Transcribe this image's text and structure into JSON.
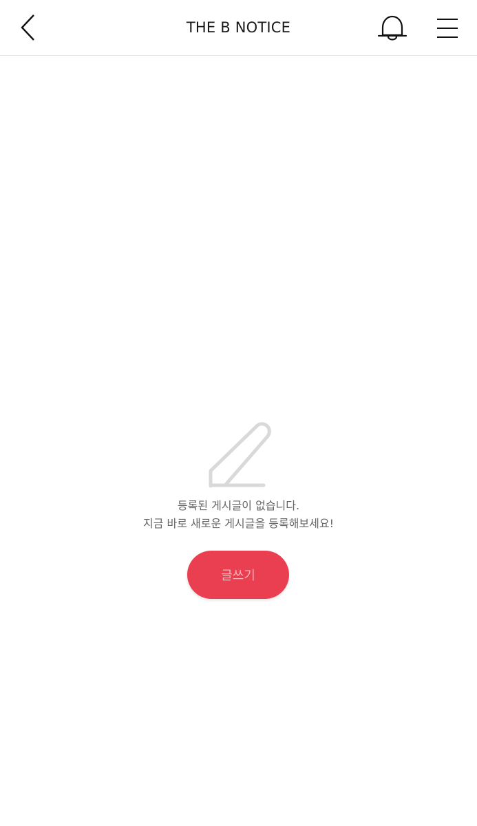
{
  "header": {
    "title": "THE B NOTICE",
    "back_icon": "chevron-left-icon",
    "bell_icon": "bell-icon",
    "menu_icon": "hamburger-menu-icon"
  },
  "empty_state": {
    "icon": "pencil-icon",
    "line1": "등록된 게시글이 없습니다.",
    "line2": "지금 바로 새로운 게시글을 등록해보세요!"
  },
  "write_button": {
    "label": "글쓰기",
    "color": "#ea3f50"
  }
}
